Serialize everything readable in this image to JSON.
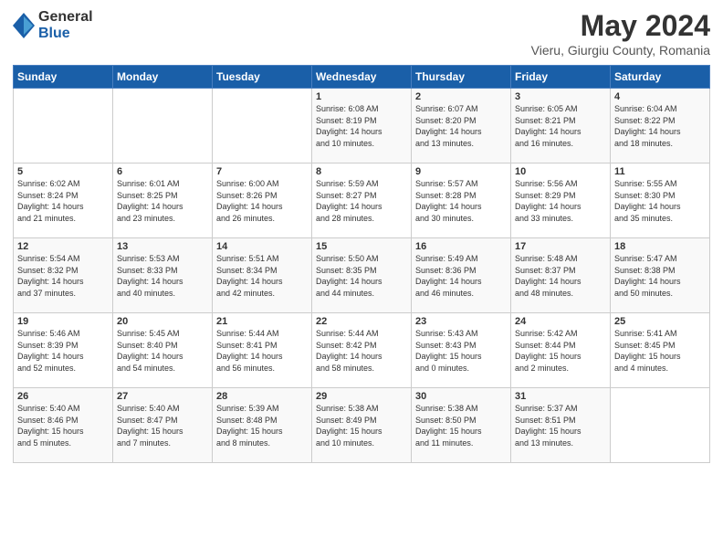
{
  "logo": {
    "general": "General",
    "blue": "Blue"
  },
  "title": {
    "month_year": "May 2024",
    "location": "Vieru, Giurgiu County, Romania"
  },
  "weekdays": [
    "Sunday",
    "Monday",
    "Tuesday",
    "Wednesday",
    "Thursday",
    "Friday",
    "Saturday"
  ],
  "weeks": [
    [
      {
        "day": "",
        "info": ""
      },
      {
        "day": "",
        "info": ""
      },
      {
        "day": "",
        "info": ""
      },
      {
        "day": "1",
        "info": "Sunrise: 6:08 AM\nSunset: 8:19 PM\nDaylight: 14 hours\nand 10 minutes."
      },
      {
        "day": "2",
        "info": "Sunrise: 6:07 AM\nSunset: 8:20 PM\nDaylight: 14 hours\nand 13 minutes."
      },
      {
        "day": "3",
        "info": "Sunrise: 6:05 AM\nSunset: 8:21 PM\nDaylight: 14 hours\nand 16 minutes."
      },
      {
        "day": "4",
        "info": "Sunrise: 6:04 AM\nSunset: 8:22 PM\nDaylight: 14 hours\nand 18 minutes."
      }
    ],
    [
      {
        "day": "5",
        "info": "Sunrise: 6:02 AM\nSunset: 8:24 PM\nDaylight: 14 hours\nand 21 minutes."
      },
      {
        "day": "6",
        "info": "Sunrise: 6:01 AM\nSunset: 8:25 PM\nDaylight: 14 hours\nand 23 minutes."
      },
      {
        "day": "7",
        "info": "Sunrise: 6:00 AM\nSunset: 8:26 PM\nDaylight: 14 hours\nand 26 minutes."
      },
      {
        "day": "8",
        "info": "Sunrise: 5:59 AM\nSunset: 8:27 PM\nDaylight: 14 hours\nand 28 minutes."
      },
      {
        "day": "9",
        "info": "Sunrise: 5:57 AM\nSunset: 8:28 PM\nDaylight: 14 hours\nand 30 minutes."
      },
      {
        "day": "10",
        "info": "Sunrise: 5:56 AM\nSunset: 8:29 PM\nDaylight: 14 hours\nand 33 minutes."
      },
      {
        "day": "11",
        "info": "Sunrise: 5:55 AM\nSunset: 8:30 PM\nDaylight: 14 hours\nand 35 minutes."
      }
    ],
    [
      {
        "day": "12",
        "info": "Sunrise: 5:54 AM\nSunset: 8:32 PM\nDaylight: 14 hours\nand 37 minutes."
      },
      {
        "day": "13",
        "info": "Sunrise: 5:53 AM\nSunset: 8:33 PM\nDaylight: 14 hours\nand 40 minutes."
      },
      {
        "day": "14",
        "info": "Sunrise: 5:51 AM\nSunset: 8:34 PM\nDaylight: 14 hours\nand 42 minutes."
      },
      {
        "day": "15",
        "info": "Sunrise: 5:50 AM\nSunset: 8:35 PM\nDaylight: 14 hours\nand 44 minutes."
      },
      {
        "day": "16",
        "info": "Sunrise: 5:49 AM\nSunset: 8:36 PM\nDaylight: 14 hours\nand 46 minutes."
      },
      {
        "day": "17",
        "info": "Sunrise: 5:48 AM\nSunset: 8:37 PM\nDaylight: 14 hours\nand 48 minutes."
      },
      {
        "day": "18",
        "info": "Sunrise: 5:47 AM\nSunset: 8:38 PM\nDaylight: 14 hours\nand 50 minutes."
      }
    ],
    [
      {
        "day": "19",
        "info": "Sunrise: 5:46 AM\nSunset: 8:39 PM\nDaylight: 14 hours\nand 52 minutes."
      },
      {
        "day": "20",
        "info": "Sunrise: 5:45 AM\nSunset: 8:40 PM\nDaylight: 14 hours\nand 54 minutes."
      },
      {
        "day": "21",
        "info": "Sunrise: 5:44 AM\nSunset: 8:41 PM\nDaylight: 14 hours\nand 56 minutes."
      },
      {
        "day": "22",
        "info": "Sunrise: 5:44 AM\nSunset: 8:42 PM\nDaylight: 14 hours\nand 58 minutes."
      },
      {
        "day": "23",
        "info": "Sunrise: 5:43 AM\nSunset: 8:43 PM\nDaylight: 15 hours\nand 0 minutes."
      },
      {
        "day": "24",
        "info": "Sunrise: 5:42 AM\nSunset: 8:44 PM\nDaylight: 15 hours\nand 2 minutes."
      },
      {
        "day": "25",
        "info": "Sunrise: 5:41 AM\nSunset: 8:45 PM\nDaylight: 15 hours\nand 4 minutes."
      }
    ],
    [
      {
        "day": "26",
        "info": "Sunrise: 5:40 AM\nSunset: 8:46 PM\nDaylight: 15 hours\nand 5 minutes."
      },
      {
        "day": "27",
        "info": "Sunrise: 5:40 AM\nSunset: 8:47 PM\nDaylight: 15 hours\nand 7 minutes."
      },
      {
        "day": "28",
        "info": "Sunrise: 5:39 AM\nSunset: 8:48 PM\nDaylight: 15 hours\nand 8 minutes."
      },
      {
        "day": "29",
        "info": "Sunrise: 5:38 AM\nSunset: 8:49 PM\nDaylight: 15 hours\nand 10 minutes."
      },
      {
        "day": "30",
        "info": "Sunrise: 5:38 AM\nSunset: 8:50 PM\nDaylight: 15 hours\nand 11 minutes."
      },
      {
        "day": "31",
        "info": "Sunrise: 5:37 AM\nSunset: 8:51 PM\nDaylight: 15 hours\nand 13 minutes."
      },
      {
        "day": "",
        "info": ""
      }
    ]
  ]
}
